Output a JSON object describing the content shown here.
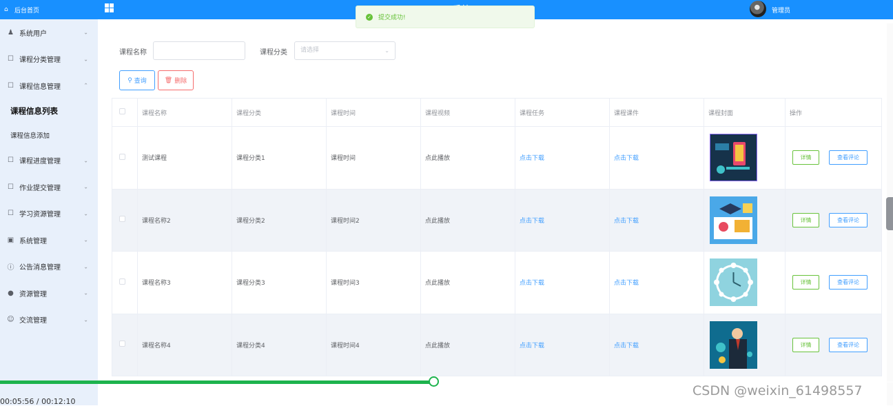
{
  "sidebar": {
    "home": "后台首页",
    "items": [
      {
        "label": "系统用户",
        "icon": "user-icon"
      },
      {
        "label": "课程分类管理",
        "icon": "doc-icon"
      },
      {
        "label": "课程信息管理",
        "icon": "doc-icon",
        "expanded": true
      },
      {
        "label": "课程进度管理",
        "icon": "doc-icon"
      },
      {
        "label": "作业提交管理",
        "icon": "doc-icon"
      },
      {
        "label": "学习资源管理",
        "icon": "doc-icon"
      },
      {
        "label": "系统管理",
        "icon": "picture-icon"
      },
      {
        "label": "公告消息管理",
        "icon": "info-icon"
      },
      {
        "label": "资源管理",
        "icon": "location-icon"
      },
      {
        "label": "交流管理",
        "icon": "chat-icon"
      }
    ],
    "subitems": [
      "课程信息列表",
      "课程信息添加"
    ]
  },
  "header": {
    "title": "... 系统",
    "user": "管理员"
  },
  "toast": {
    "message": "提交成功!"
  },
  "filters": {
    "course_name_label": "课程名称",
    "course_name_value": "",
    "category_label": "课程分类",
    "category_placeholder": "请选择"
  },
  "actions": {
    "search": "查询",
    "delete": "删除"
  },
  "table": {
    "headers": [
      "",
      "课程名称",
      "课程分类",
      "课程时间",
      "课程视频",
      "课程任务",
      "课程课件",
      "课程封面",
      "操作"
    ],
    "rows": [
      {
        "name": "测试课程",
        "category": "课程分类1",
        "time": "课程时间",
        "video": "点此播放",
        "task": "点击下载",
        "courseware": "点击下载",
        "cover": "phone-app-illustration"
      },
      {
        "name": "课程名称2",
        "category": "课程分类2",
        "time": "课程时间2",
        "video": "点此播放",
        "task": "点击下载",
        "courseware": "点击下载",
        "cover": "graduation-illustration"
      },
      {
        "name": "课程名称3",
        "category": "课程分类3",
        "time": "课程时间3",
        "video": "点此播放",
        "task": "点击下载",
        "courseware": "点击下载",
        "cover": "clock-illustration"
      },
      {
        "name": "课程名称4",
        "category": "课程分类4",
        "time": "课程时间4",
        "video": "点此播放",
        "task": "点击下载",
        "courseware": "点击下载",
        "cover": "businessman-illustration"
      }
    ],
    "op_detail": "详情",
    "op_comment": "查看评论"
  },
  "video_player": {
    "time": "00:05:56 / 00:12:10",
    "progress": 0.485
  },
  "watermark": "CSDN @weixin_61498557"
}
